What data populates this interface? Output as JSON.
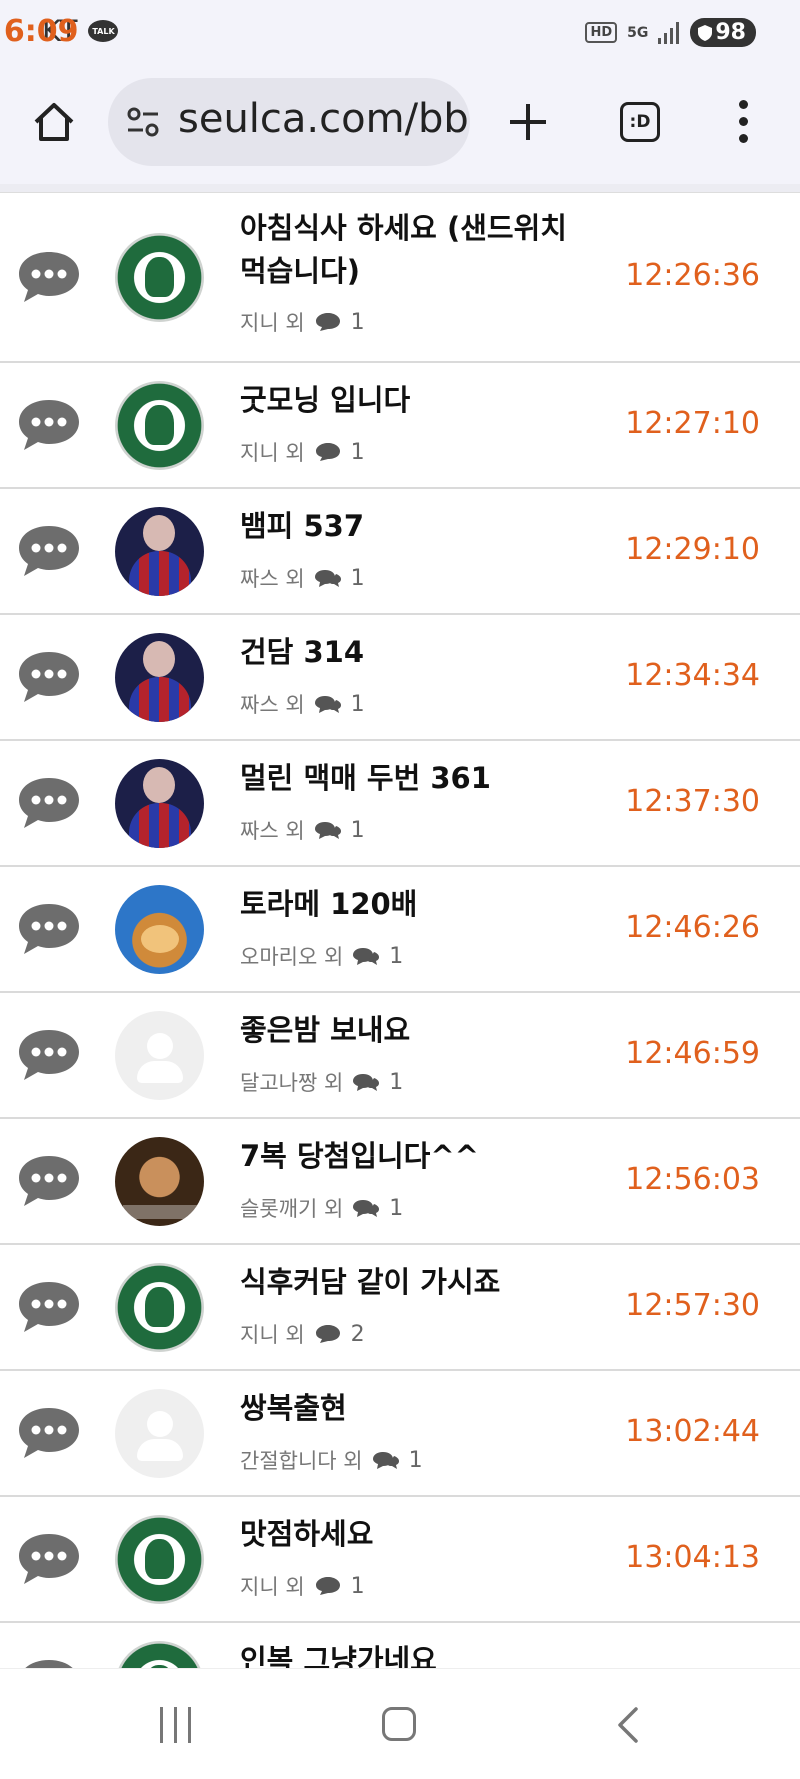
{
  "status": {
    "carrier": "KT",
    "time": "6:09",
    "talk_badge": "TALK",
    "hd": "HD",
    "network": "5G",
    "battery": "98"
  },
  "browser": {
    "url": "seulca.com/bbs",
    "tabs_label": ":D"
  },
  "posts": [
    {
      "title": "아침식사 하세요 (샌드위치 먹습니다)",
      "author": "지니 외",
      "comments": "1",
      "time": "12:26:36",
      "avatar": "starbucks"
    },
    {
      "title": "굿모닝 입니다",
      "author": "지니 외",
      "comments": "1",
      "time": "12:27:10",
      "avatar": "starbucks"
    },
    {
      "title": "뱀피 537",
      "author": "짜스 외",
      "comments": "1",
      "time": "12:29:10",
      "avatar": "man"
    },
    {
      "title": "건담 314",
      "author": "짜스 외",
      "comments": "1",
      "time": "12:34:34",
      "avatar": "man"
    },
    {
      "title": "멀린 맥매 두번 361",
      "author": "짜스 외",
      "comments": "1",
      "time": "12:37:30",
      "avatar": "man"
    },
    {
      "title": "토라메 120배",
      "author": "오마리오 외",
      "comments": "1",
      "time": "12:46:26",
      "avatar": "cat"
    },
    {
      "title": "좋은밤 보내요",
      "author": "달고나짱 외",
      "comments": "1",
      "time": "12:46:59",
      "avatar": "blank"
    },
    {
      "title": "7복 당첨입니다^^",
      "author": "슬롯깨기 외",
      "comments": "1",
      "time": "12:56:03",
      "avatar": "shout"
    },
    {
      "title": "식후커담 같이 가시죠",
      "author": "지니 외",
      "comments": "2",
      "time": "12:57:30",
      "avatar": "starbucks"
    },
    {
      "title": "쌍복출현",
      "author": "간절합니다 외",
      "comments": "1",
      "time": "13:02:44",
      "avatar": "blank"
    },
    {
      "title": "맛점하세요",
      "author": "지니 외",
      "comments": "1",
      "time": "13:04:13",
      "avatar": "starbucks"
    },
    {
      "title": "인복 그냥가네요",
      "author": "",
      "comments": "",
      "time": "",
      "avatar": "starbucks"
    }
  ],
  "colors": {
    "time": "#e0601d",
    "bar_bg": "#f3f3fa"
  },
  "icons": {
    "home": "home-icon",
    "site_info": "site-info-icon",
    "new_tab": "plus-icon",
    "menu": "kebab-menu-icon",
    "chat": "chat-bubble-icon",
    "comment": "comment-icon"
  }
}
